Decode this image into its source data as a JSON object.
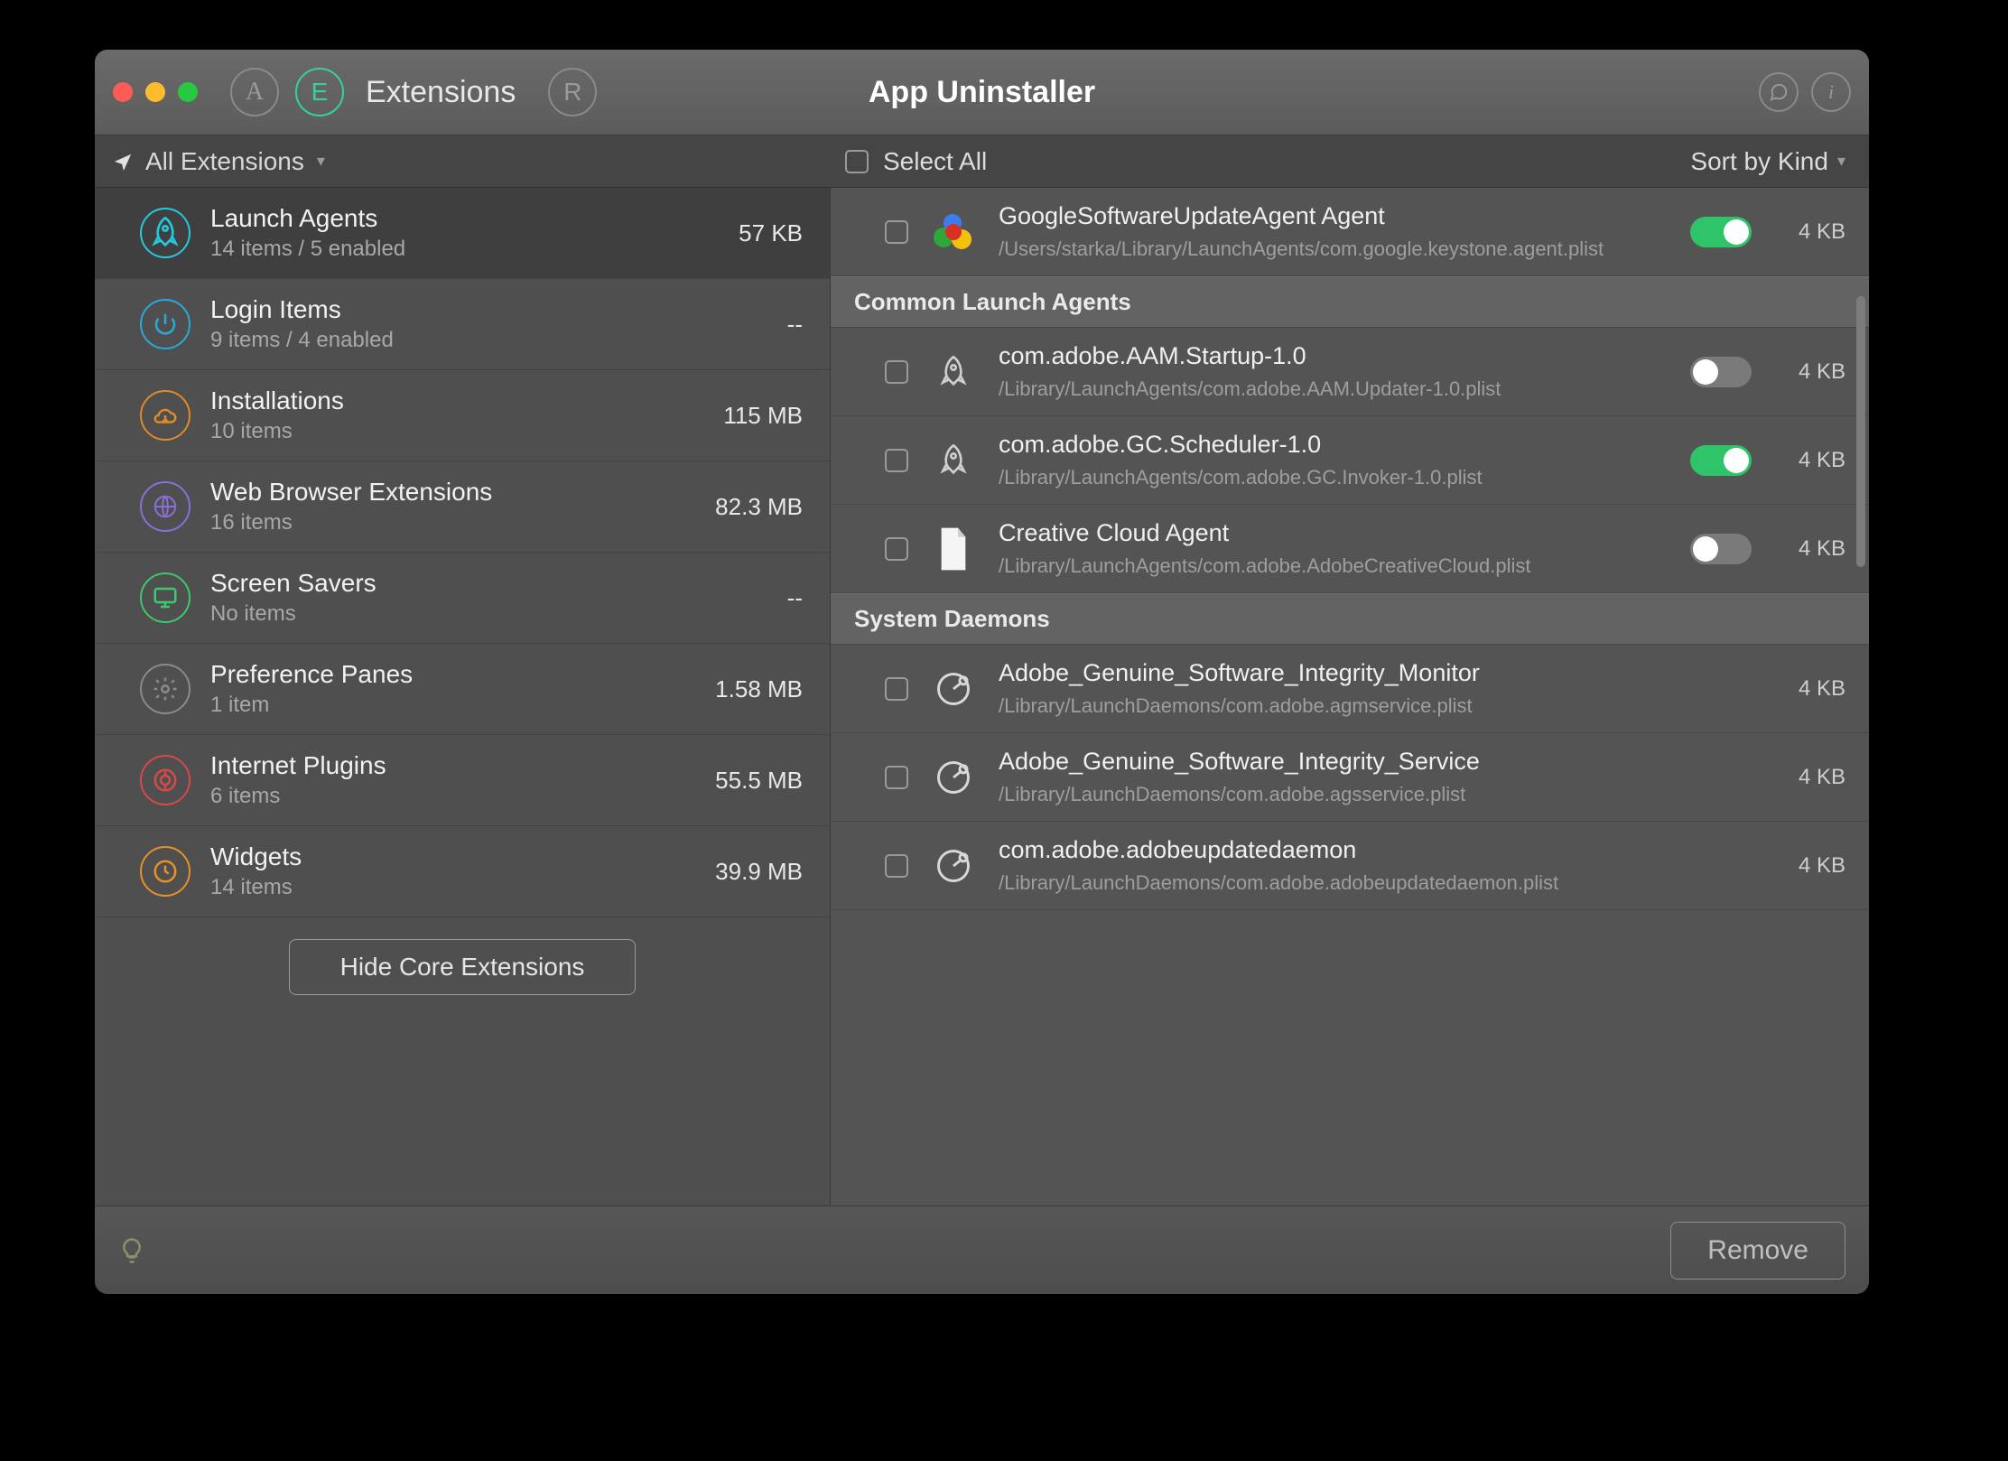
{
  "colors": {
    "accent_green": "#2fc36a",
    "active_circle": "#35d29b"
  },
  "titlebar": {
    "app_title": "App Uninstaller",
    "tabs": {
      "extensions_label": "Extensions"
    }
  },
  "filterbar": {
    "filter_label": "All Extensions",
    "select_all_label": "Select All",
    "sort_label": "Sort by Kind"
  },
  "sidebar": {
    "hide_button": "Hide Core Extensions",
    "categories": [
      {
        "id": "launch-agents",
        "title": "Launch Agents",
        "sub": "14 items / 5 enabled",
        "size": "57 KB",
        "icon": "rocket",
        "color": "#26c8e0",
        "active": true
      },
      {
        "id": "login-items",
        "title": "Login Items",
        "sub": "9 items / 4 enabled",
        "size": "--",
        "icon": "power",
        "color": "#2aa9d6"
      },
      {
        "id": "installations",
        "title": "Installations",
        "sub": "10 items",
        "size": "115 MB",
        "icon": "cloud-down",
        "color": "#e08a2a"
      },
      {
        "id": "web-ext",
        "title": "Web Browser Extensions",
        "sub": "16 items",
        "size": "82.3 MB",
        "icon": "globe",
        "color": "#8a6fd6"
      },
      {
        "id": "screen-savers",
        "title": "Screen Savers",
        "sub": "No items",
        "size": "--",
        "icon": "monitor",
        "color": "#3ec96f"
      },
      {
        "id": "pref-panes",
        "title": "Preference Panes",
        "sub": "1 item",
        "size": "1.58 MB",
        "icon": "gear",
        "color": "#8a8a8a"
      },
      {
        "id": "internet-plugins",
        "title": "Internet Plugins",
        "sub": "6 items",
        "size": "55.5 MB",
        "icon": "plug",
        "color": "#d64a4a"
      },
      {
        "id": "widgets",
        "title": "Widgets",
        "sub": "14 items",
        "size": "39.9 MB",
        "icon": "widget",
        "color": "#e8902a"
      }
    ]
  },
  "detail": {
    "top_item": {
      "title": "GoogleSoftwareUpdateAgent Agent",
      "path": "/Users/starka/Library/LaunchAgents/com.google.keystone.agent.plist",
      "size": "4 KB",
      "toggle": "on",
      "icon": "balls"
    },
    "sections": [
      {
        "header": "Common Launch Agents",
        "items": [
          {
            "title": "com.adobe.AAM.Startup-1.0",
            "path": "/Library/LaunchAgents/com.adobe.AAM.Updater-1.0.plist",
            "size": "4 KB",
            "toggle": "off",
            "icon": "rocket"
          },
          {
            "title": "com.adobe.GC.Scheduler-1.0",
            "path": "/Library/LaunchAgents/com.adobe.GC.Invoker-1.0.plist",
            "size": "4 KB",
            "toggle": "on",
            "icon": "rocket"
          },
          {
            "title": "Creative Cloud Agent",
            "path": "/Library/LaunchAgents/com.adobe.AdobeCreativeCloud.plist",
            "size": "4 KB",
            "toggle": "off",
            "icon": "document"
          }
        ]
      },
      {
        "header": "System Daemons",
        "items": [
          {
            "title": "Adobe_Genuine_Software_Integrity_Monitor",
            "path": "/Library/LaunchDaemons/com.adobe.agmservice.plist",
            "size": "4 KB",
            "icon": "gauge"
          },
          {
            "title": "Adobe_Genuine_Software_Integrity_Service",
            "path": "/Library/LaunchDaemons/com.adobe.agsservice.plist",
            "size": "4 KB",
            "icon": "gauge"
          },
          {
            "title": "com.adobe.adobeupdatedaemon",
            "path": "/Library/LaunchDaemons/com.adobe.adobeupdatedaemon.plist",
            "size": "4 KB",
            "icon": "gauge"
          }
        ]
      }
    ]
  },
  "footer": {
    "remove_label": "Remove"
  }
}
